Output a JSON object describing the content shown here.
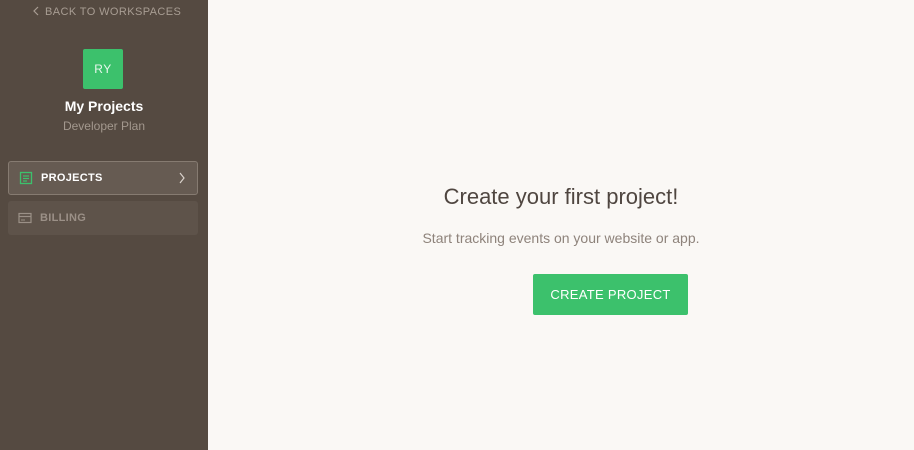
{
  "sidebar": {
    "back_link": "BACK TO WORKSPACES",
    "avatar_initials": "RY",
    "workspace_name": "My Projects",
    "workspace_plan": "Developer Plan",
    "nav": [
      {
        "label": "PROJECTS",
        "icon": "projects-icon",
        "active": true
      },
      {
        "label": "BILLING",
        "icon": "billing-card-icon",
        "active": false
      }
    ]
  },
  "main": {
    "title": "Create your first project!",
    "subtitle": "Start tracking events on your website or app.",
    "button_label": "CREATE PROJECT"
  },
  "colors": {
    "sidebar_bg": "#554a41",
    "accent_green": "#3cc16c",
    "main_bg": "#faf8f5"
  }
}
